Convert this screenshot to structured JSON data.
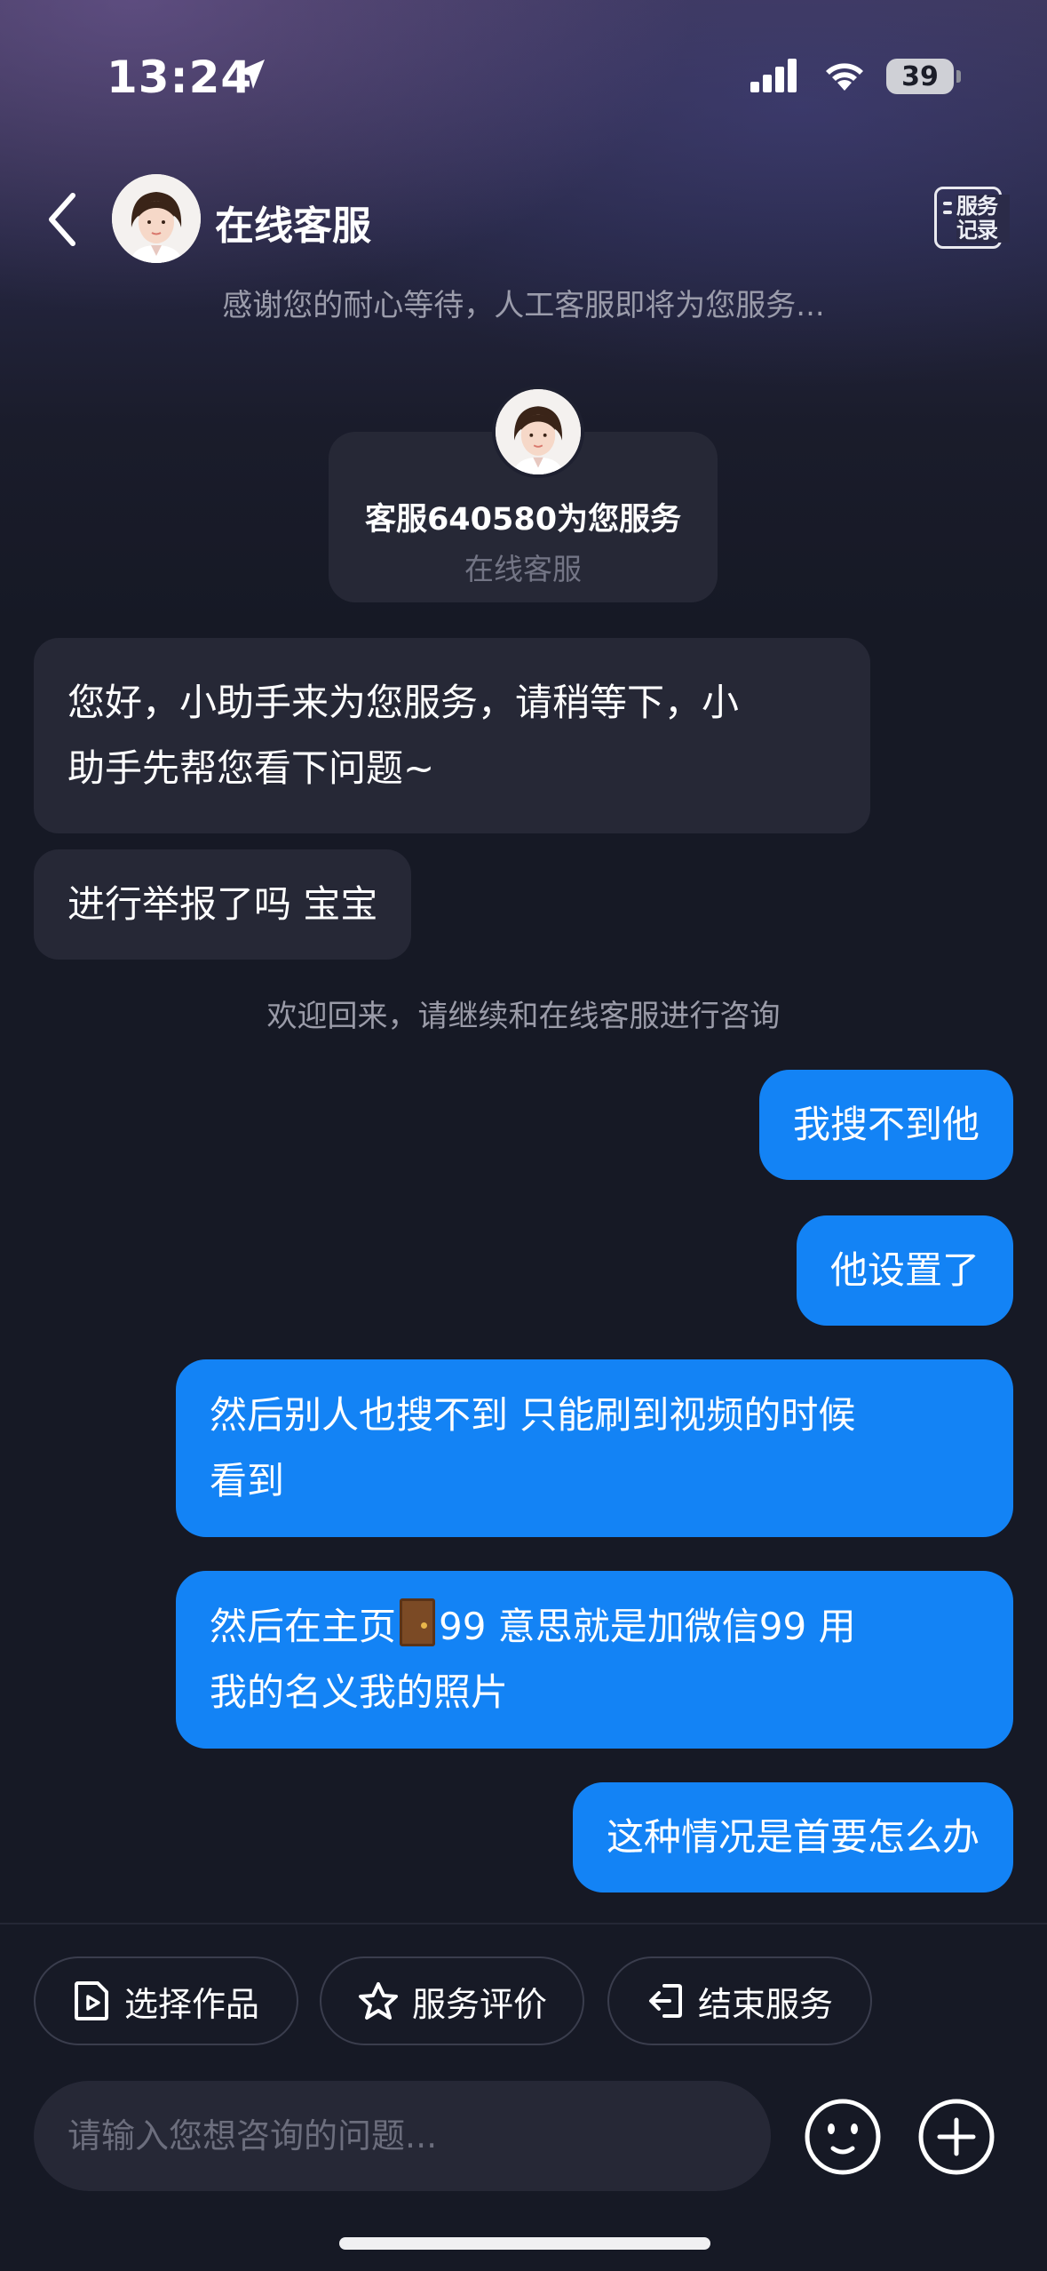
{
  "status_bar": {
    "time": "13:24",
    "battery": "39"
  },
  "header": {
    "title": "在线客服",
    "subtitle": "感谢您的耐心等待，人工客服即将为您服务...",
    "service_record_label": "服务记录"
  },
  "agent_card": {
    "title": "客服640580为您服务",
    "subtitle": "在线客服"
  },
  "messages": [
    {
      "from": "agent",
      "lines": [
        "您好，小助手来为您服务，请稍等下，小",
        "助手先帮您看下问题~"
      ]
    },
    {
      "from": "agent",
      "lines": [
        "进行举报了吗 宝宝"
      ]
    },
    {
      "from": "user",
      "lines": [
        "我搜不到他"
      ]
    },
    {
      "from": "user",
      "lines": [
        "他设置了"
      ]
    },
    {
      "from": "user",
      "lines": [
        "然后别人也搜不到 只能刷到视频的时候",
        "看到"
      ]
    },
    {
      "from": "user",
      "lines": [
        "然后在主页",
        "99 意思就是加微信99 用",
        "我的名义我的照片"
      ],
      "emoji": "door"
    },
    {
      "from": "user",
      "lines": [
        "这种情况是首要怎么办"
      ]
    }
  ],
  "system_note": "欢迎回来，请继续和在线客服进行咨询",
  "actions": [
    {
      "label": "选择作品",
      "icon": "play-document-icon"
    },
    {
      "label": "服务评价",
      "icon": "star-icon"
    },
    {
      "label": "结束服务",
      "icon": "exit-icon"
    }
  ],
  "input": {
    "placeholder": "请输入您想咨询的问题..."
  },
  "colors": {
    "user_bubble": "#1383f5",
    "agent_bubble": "#262836",
    "background": "#161925"
  }
}
